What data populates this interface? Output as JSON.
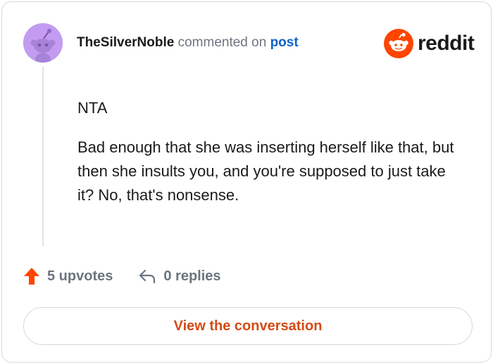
{
  "comment": {
    "username": "TheSilverNoble",
    "action_text": "commented on",
    "target_link": "post",
    "paragraphs": [
      "NTA",
      "Bad enough that she was inserting herself like that, but then she insults you, and you're supposed to just take it? No, that's nonsense."
    ]
  },
  "brand": {
    "wordmark": "reddit",
    "color": "#ff4500"
  },
  "stats": {
    "upvotes": "5 upvotes",
    "replies": "0 replies"
  },
  "cta": {
    "label": "View the conversation"
  },
  "colors": {
    "accent": "#ff4500",
    "link": "#0b63c9",
    "cta_text": "#d24d14",
    "avatar_bg": "#c39bf0"
  },
  "icons": {
    "avatar": "snoo-avatar-icon",
    "logo": "reddit-logo-icon",
    "upvote": "upvote-arrow-icon",
    "reply": "reply-arrow-icon"
  }
}
